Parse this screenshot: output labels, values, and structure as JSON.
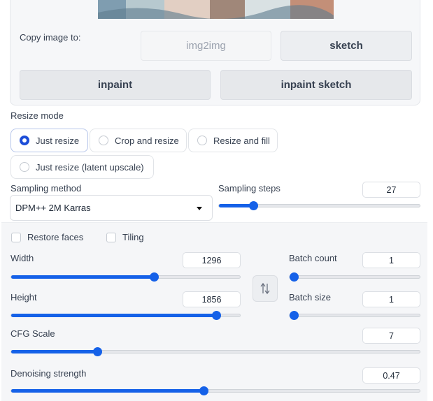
{
  "copy_image": {
    "label": "Copy image to:",
    "buttons": {
      "img2img": "img2img",
      "sketch": "sketch",
      "inpaint": "inpaint",
      "inpaint_sketch": "inpaint sketch"
    }
  },
  "resize_mode": {
    "label": "Resize mode",
    "options": [
      "Just resize",
      "Crop and resize",
      "Resize and fill",
      "Just resize (latent upscale)"
    ],
    "selected": "Just resize"
  },
  "sampling_method": {
    "label": "Sampling method",
    "value": "DPM++ 2M Karras"
  },
  "sampling_steps": {
    "label": "Sampling steps",
    "value": "27",
    "fraction": 0.17
  },
  "checkboxes": {
    "restore_faces": "Restore faces",
    "tiling": "Tiling"
  },
  "width": {
    "label": "Width",
    "value": "1296",
    "fraction": 0.62
  },
  "height": {
    "label": "Height",
    "value": "1856",
    "fraction": 0.89
  },
  "batch_count": {
    "label": "Batch count",
    "value": "1",
    "fraction": 0.0
  },
  "batch_size": {
    "label": "Batch size",
    "value": "1",
    "fraction": 0.0
  },
  "cfg_scale": {
    "label": "CFG Scale",
    "value": "7",
    "fraction": 0.21
  },
  "denoising_strength": {
    "label": "Denoising strength",
    "value": "0.47",
    "fraction": 0.47
  },
  "icons": {
    "swap": "swap-vertical-icon",
    "dropdown": "chevron-down-icon"
  },
  "colors": {
    "accent": "#1561e8",
    "radio_checked": "#1d4ed8"
  }
}
